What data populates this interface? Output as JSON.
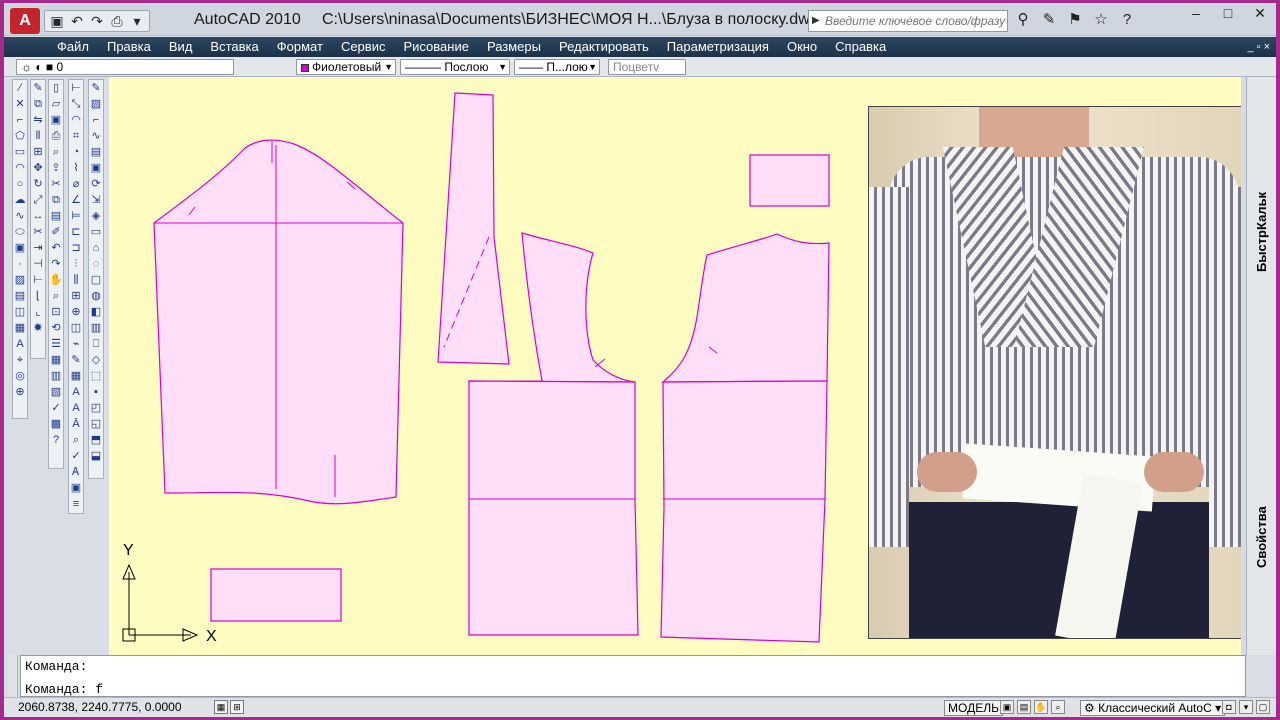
{
  "window": {
    "app_title": "AutoCAD 2010",
    "file_path": "C:\\Users\\ninasa\\Documents\\БИЗНЕС\\МОЯ Н...\\Блуза в полоску.dwg",
    "search_placeholder": "Введите ключевое слово/фразу"
  },
  "menubar": {
    "items": [
      "Файл",
      "Правка",
      "Вид",
      "Вставка",
      "Формат",
      "Сервис",
      "Рисование",
      "Размеры",
      "Редактировать",
      "Параметризация",
      "Окно",
      "Справка"
    ]
  },
  "layerbar": {
    "layer": "0",
    "color": "Фиолетовый",
    "linetype": "Послою",
    "lineweight": "П...лою",
    "plotstyle": "Поцветv"
  },
  "canvas": {
    "background": "#fffcc2",
    "pattern_stroke": "#d400d4",
    "pattern_fill": "#ffdff8",
    "axis_x": "X",
    "axis_y": "Y"
  },
  "right_panel": {
    "tab_top": "БыстрКальк",
    "tab_bottom": "Свойства"
  },
  "command": {
    "line1": "Команда:",
    "line2": "Команда: f"
  },
  "status": {
    "coords": "2060.8738, 2240.7775, 0.0000",
    "model": "МОДЕЛЬ",
    "workspace": "Классический AutoC"
  },
  "photo": {
    "alt": "woman in striped blouse with white belt"
  }
}
